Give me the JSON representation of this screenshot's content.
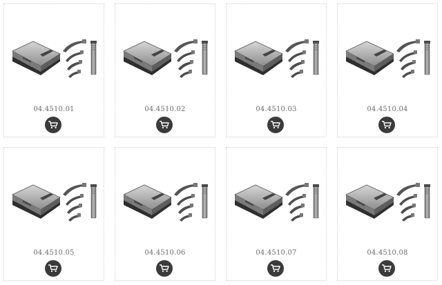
{
  "products": [
    {
      "code": "04.4510.01",
      "image_icon": "laryngoscope-set-image",
      "action_icon": "cart-icon"
    },
    {
      "code": "04.4510.02",
      "image_icon": "laryngoscope-set-image",
      "action_icon": "cart-icon"
    },
    {
      "code": "04.4510.03",
      "image_icon": "laryngoscope-set-image",
      "action_icon": "cart-icon"
    },
    {
      "code": "04.4510.04",
      "image_icon": "laryngoscope-set-image",
      "action_icon": "cart-icon"
    },
    {
      "code": "04.4510.05",
      "image_icon": "laryngoscope-set-image",
      "action_icon": "cart-icon"
    },
    {
      "code": "04.4510.06",
      "image_icon": "laryngoscope-set-image",
      "action_icon": "cart-icon"
    },
    {
      "code": "04.4510.07",
      "image_icon": "laryngoscope-set-image",
      "action_icon": "cart-icon"
    },
    {
      "code": "04.4510.08",
      "image_icon": "laryngoscope-set-image",
      "action_icon": "cart-icon"
    }
  ],
  "colors": {
    "button_bg": "#3b3b3b",
    "code_text": "#6a6a6a",
    "card_border": "#cfcfcf"
  }
}
